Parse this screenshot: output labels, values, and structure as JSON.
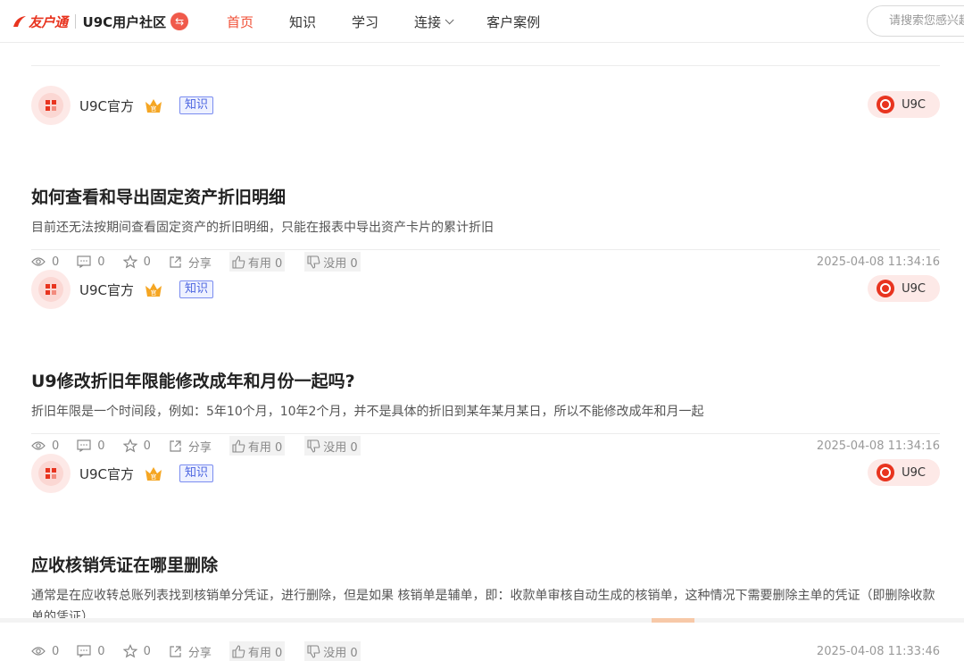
{
  "header": {
    "logo_text": "友户通",
    "brand_name": "U9C用户社区",
    "brand_switch_icon": "⇆",
    "nav": [
      {
        "label": "首页",
        "active": true
      },
      {
        "label": "知识",
        "active": false
      },
      {
        "label": "学习",
        "active": false
      },
      {
        "label": "连接",
        "active": false,
        "dropdown": true
      },
      {
        "label": "客户案例",
        "active": false
      }
    ],
    "search_placeholder": "请搜索您感兴趣的内容"
  },
  "posts": [
    {
      "author": "U9C官方",
      "tag": "知识",
      "product": "U9C",
      "title": "如何查看和导出固定资产折旧明细",
      "summary": "目前还无法按期间查看固定资产的折旧明细，只能在报表中导出资产卡片的累计折旧",
      "views": "0",
      "comments": "0",
      "favorites": "0",
      "share_label": "分享",
      "useful_label": "有用 0",
      "useless_label": "没用 0",
      "timestamp": "2025-04-08 11:34:16"
    },
    {
      "author": "U9C官方",
      "tag": "知识",
      "product": "U9C",
      "title": "U9修改折旧年限能修改成年和月份一起吗?",
      "summary": "折旧年限是一个时间段，例如：5年10个月，10年2个月，并不是具体的折旧到某年某月某日，所以不能修改成年和月一起",
      "views": "0",
      "comments": "0",
      "favorites": "0",
      "share_label": "分享",
      "useful_label": "有用 0",
      "useless_label": "没用 0",
      "timestamp": "2025-04-08 11:34:16"
    },
    {
      "author": "U9C官方",
      "tag": "知识",
      "product": "U9C",
      "title": "应收核销凭证在哪里删除",
      "summary": "通常是在应收转总账列表找到核销单分凭证，进行删除，但是如果 核销单是辅单，即：收款单审核自动生成的核销单，这种情况下需要删除主单的凭证（即删除收款单的凭证）",
      "views": "0",
      "comments": "0",
      "favorites": "0",
      "share_label": "分享",
      "useful_label": "有用 0",
      "useless_label": "没用 0",
      "timestamp": "2025-04-08 11:33:46"
    }
  ],
  "colors": {
    "accent": "#f04f36",
    "tag_blue": "#4a63e0",
    "product_pill_bg": "#fde9e7"
  },
  "icons": {
    "views": "eye-icon",
    "comments": "comment-icon",
    "favorites": "star-icon",
    "share": "share-icon",
    "useful": "thumbs-up-icon",
    "useless": "thumbs-down-icon",
    "official": "crown-icon",
    "search": "search-icon"
  }
}
